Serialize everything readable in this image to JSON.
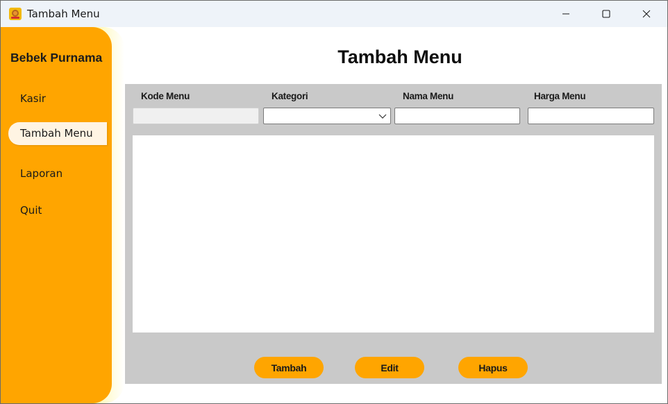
{
  "window": {
    "title": "Tambah Menu",
    "icon": "app-food-icon",
    "controls": [
      "minimize-icon",
      "maximize-icon",
      "close-icon"
    ]
  },
  "sidebar": {
    "brand": "Bebek Purnama",
    "items": [
      {
        "label": "Kasir",
        "active": false
      },
      {
        "label": "Tambah Menu",
        "active": true
      },
      {
        "label": "Laporan",
        "active": false
      },
      {
        "label": "Quit",
        "active": false
      }
    ]
  },
  "main": {
    "title": "Tambah Menu",
    "form": {
      "kode_label": "Kode Menu",
      "kode_value": "",
      "kategori_label": "Kategori",
      "kategori_value": "",
      "nama_label": "Nama Menu",
      "nama_value": "",
      "harga_label": "Harga Menu",
      "harga_value": ""
    },
    "buttons": {
      "add": "Tambah",
      "edit": "Edit",
      "delete": "Hapus"
    }
  },
  "colors": {
    "accent": "#ffa500",
    "sidebar_glow": "#ffe53a",
    "panel": "#c9c9c9",
    "active_item": "#fff4e3",
    "titlebar": "#eef3f9"
  }
}
